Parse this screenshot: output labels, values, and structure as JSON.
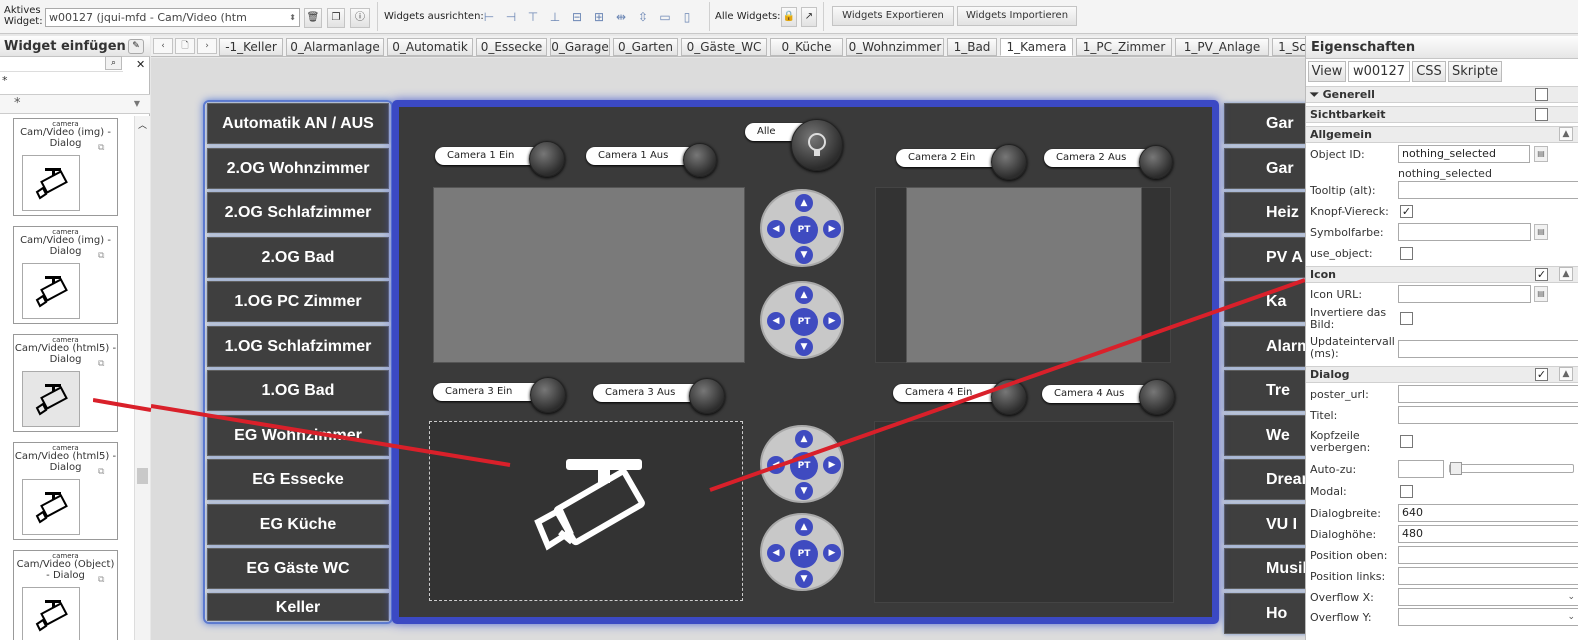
{
  "toolbar": {
    "active_widget_label": "Aktives Widget:",
    "active_widget_value": "w00127 (jqui-mfd - Cam/Video (htm",
    "align_label": "Widgets ausrichten:",
    "all_widgets_label": "Alle Widgets:",
    "export_label": "Widgets Exportieren",
    "import_label": "Widgets Importieren"
  },
  "left_panel": {
    "title": "Widget einfügen",
    "filter_value": "*",
    "category_value": "*",
    "widgets": [
      {
        "category": "camera",
        "name": "Cam/Video (img) - Dialog"
      },
      {
        "category": "camera",
        "name": "Cam/Video (img) - Dialog"
      },
      {
        "category": "camera",
        "name": "Cam/Video (html5) - Dialog"
      },
      {
        "category": "camera",
        "name": "Cam/Video (html5) - Dialog"
      },
      {
        "category": "camera",
        "name": "Cam/Video (Object) - Dialog"
      }
    ]
  },
  "view_tabs": [
    "-1_Keller",
    "0_Alarmanlage",
    "0_Automatik",
    "0_Essecke",
    "0_Garage",
    "0_Garten",
    "0_Gäste_WC",
    "0_Küche",
    "0_Wohnzimmer",
    "1_Bad",
    "1_Kamera",
    "1_PC_Zimmer",
    "1_PV_Anlage",
    "1_Sc"
  ],
  "active_view_tab": "1_Kamera",
  "canvas": {
    "nav_buttons": [
      "Automatik AN / AUS",
      "2.OG Wohnzimmer",
      "2.OG Schlafzimmer",
      "2.OG Bad",
      "1.OG PC Zimmer",
      "1.OG Schlafzimmer",
      "1.OG Bad",
      "EG Wohnzimmer",
      "EG Essecke",
      "EG Küche",
      "EG Gäste WC",
      "Keller"
    ],
    "right_nav_buttons": [
      "Gar",
      "Gar",
      "Heiz",
      "PV A",
      "Ka",
      "Alarm",
      "Tre",
      "We",
      "Dreamb",
      "VU I",
      "Musik",
      "Ho"
    ],
    "toggles": {
      "cam1_on": "Camera 1 Ein",
      "cam1_off": "Camera 1 Aus",
      "all": "Alle",
      "cam2_on": "Camera  2 Ein",
      "cam2_off": "Camera 2 Aus",
      "cam3_on": "Camera  3 Ein",
      "cam3_off": "Camera 3 Aus",
      "cam4_on": "Camera  4 Ein",
      "cam4_off": "Camera 4 Aus"
    },
    "ptz_label": "PT",
    "accent_color": "#3b49c4",
    "annotation_color": "#d9202a"
  },
  "properties": {
    "title": "Eigenschaften",
    "tabs": [
      "View",
      "w00127",
      "CSS",
      "Skripte"
    ],
    "sections": {
      "generell": "Generell",
      "sichtbarkeit": "Sichtbarkeit",
      "allgemein": "Allgemein",
      "icon": "Icon",
      "dialog": "Dialog"
    },
    "fields": {
      "object_id_label": "Object ID:",
      "object_id_value": "nothing_selected",
      "object_id_hint": "nothing_selected",
      "tooltip_label": "Tooltip (alt):",
      "knopf_label": "Knopf-Viereck:",
      "symbolfarbe_label": "Symbolfarbe:",
      "use_object_label": "use_object:",
      "icon_url_label": "Icon URL:",
      "invert_label": "Invertiere das Bild:",
      "update_label": "Updateintervall (ms):",
      "poster_label": "poster_url:",
      "titel_label": "Titel:",
      "kopfzeile_label": "Kopfzeile verbergen:",
      "autozu_label": "Auto-zu:",
      "modal_label": "Modal:",
      "dialogbreite_label": "Dialogbreite:",
      "dialogbreite_value": "640",
      "dialoghoehe_label": "Dialoghöhe:",
      "dialoghoehe_value": "480",
      "pos_oben_label": "Position oben:",
      "pos_links_label": "Position links:",
      "overflow_x_label": "Overflow X:",
      "overflow_y_label": "Overflow Y:"
    }
  }
}
